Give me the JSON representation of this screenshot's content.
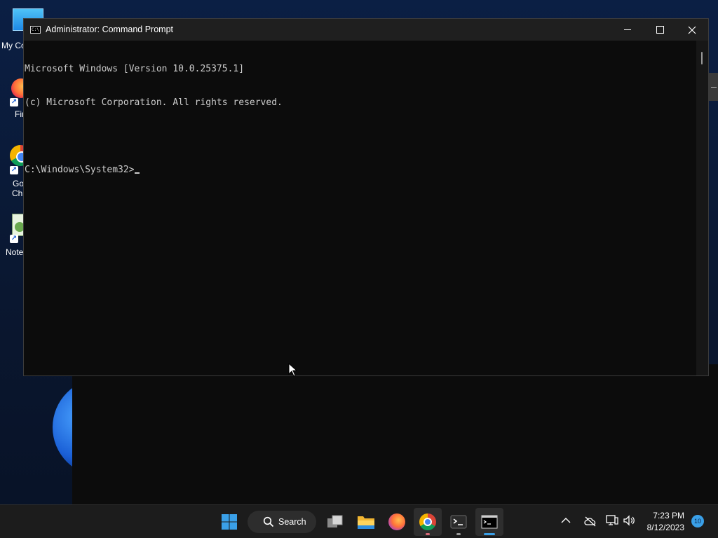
{
  "desktop": {
    "icons": [
      {
        "label": "My Co",
        "icon": "monitor-icon"
      },
      {
        "label": "Fir",
        "icon": "firefox-icon"
      },
      {
        "label": "Go",
        "label2": "Chr",
        "icon": "chrome-icon"
      },
      {
        "label": "Note",
        "icon": "notepad-icon"
      }
    ]
  },
  "window": {
    "title": "Administrator: Command Prompt",
    "icon_text": "C:\\",
    "lines": [
      "Microsoft Windows [Version 10.0.25375.1]",
      "(c) Microsoft Corporation. All rights reserved.",
      "",
      "C:\\Windows\\System32>"
    ]
  },
  "taskbar": {
    "search_label": "Search",
    "apps": [
      "start-icon",
      "search",
      "task-view-icon",
      "file-explorer-icon",
      "firefox-icon",
      "chrome-icon",
      "terminal-icon",
      "command-prompt-icon"
    ],
    "time": "7:23 PM",
    "date": "8/12/2023",
    "notification_count": "10"
  },
  "colors": {
    "accent": "#3aa0e8",
    "console_bg": "#0c0c0c",
    "console_text": "#cccccc"
  }
}
